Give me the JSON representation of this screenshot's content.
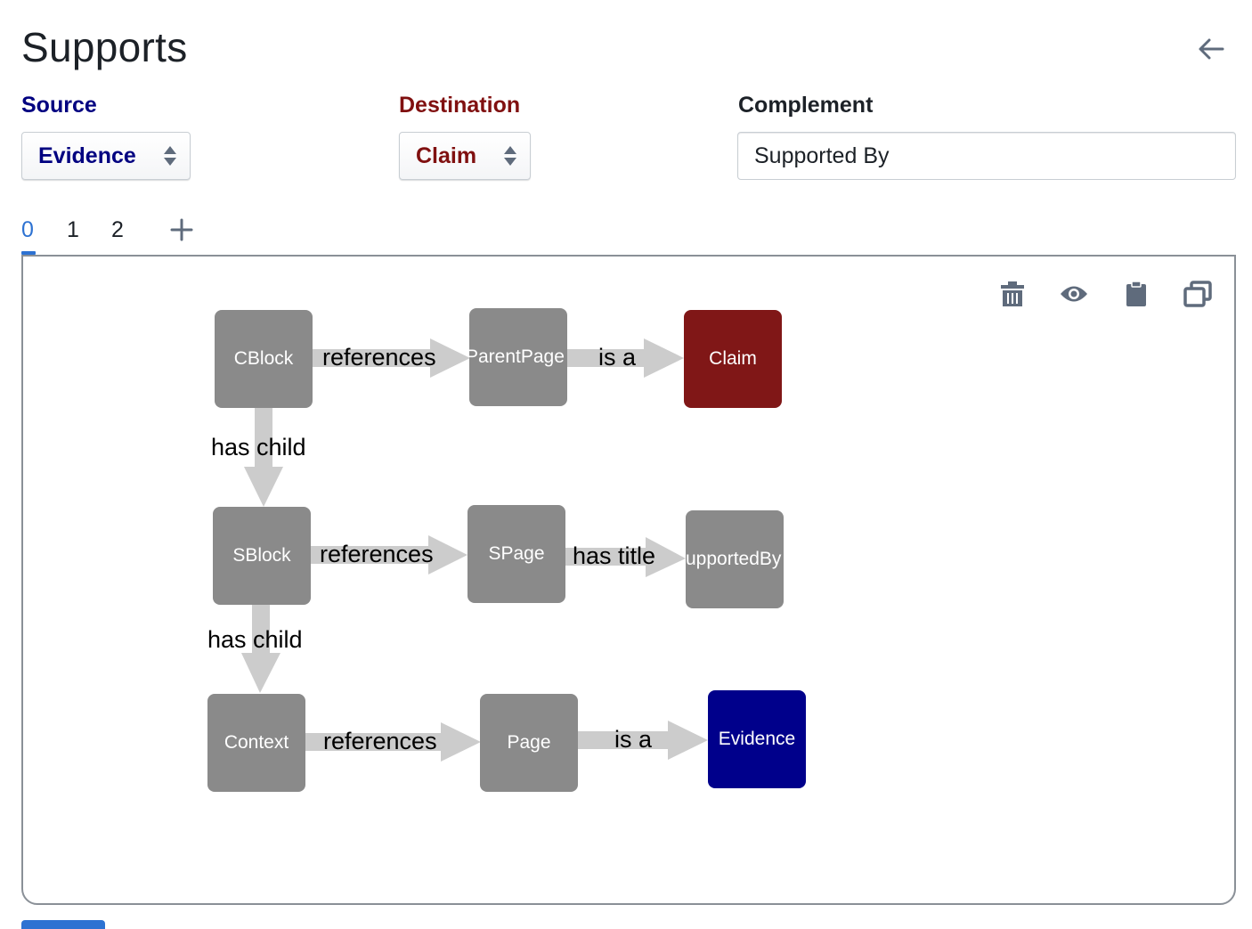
{
  "header": {
    "title": "Supports",
    "back_icon": "arrow-left-icon"
  },
  "source": {
    "label": "Source",
    "value": "Evidence",
    "color": "#000080"
  },
  "destination": {
    "label": "Destination",
    "value": "Claim",
    "color": "#801010"
  },
  "complement": {
    "label": "Complement",
    "value": "Supported By"
  },
  "tabs": {
    "items": [
      "0",
      "1",
      "2"
    ],
    "active_index": 0,
    "add_icon": "plus-icon"
  },
  "toolbar": {
    "icons": [
      "trash-icon",
      "eye-icon",
      "clipboard-icon",
      "duplicate-icon"
    ]
  },
  "graph": {
    "node_color": "#8a8a8a",
    "edge_color": "#cccccc",
    "nodes": {
      "cblock": "CBlock",
      "parentpage": "ParentPage",
      "claim": "Claim",
      "sblock": "SBlock",
      "spage": "SPage",
      "supportedby": "SupportedBy",
      "context": "Context",
      "page": "Page",
      "evidence": "Evidence"
    },
    "edges": {
      "cblock_parentpage": "references",
      "parentpage_claim": "is a",
      "cblock_sblock": "has child",
      "sblock_spage": "references",
      "spage_supportedby": "has title",
      "sblock_context": "has child",
      "context_page": "references",
      "page_evidence": "is a"
    },
    "highlight_colors": {
      "claim": "#801717",
      "evidence": "#00008b"
    }
  }
}
